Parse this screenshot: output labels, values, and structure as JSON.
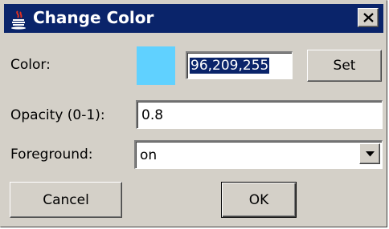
{
  "window": {
    "title": "Change Color"
  },
  "icons": {
    "app": "java-cup-icon",
    "close": "close-icon",
    "dropdown": "chevron-down-icon"
  },
  "colors": {
    "title_bar": "#0a246a",
    "window_bg": "#d4d0c8",
    "swatch": "#60d1ff",
    "selection": "#0a246a"
  },
  "color_row": {
    "label": "Color:",
    "value": "96,209,255",
    "set_label": "Set"
  },
  "opacity_row": {
    "label": "Opacity (0-1):",
    "value": "0.8"
  },
  "foreground_row": {
    "label": "Foreground:",
    "selected": "on"
  },
  "buttons": {
    "cancel": "Cancel",
    "ok": "OK"
  }
}
